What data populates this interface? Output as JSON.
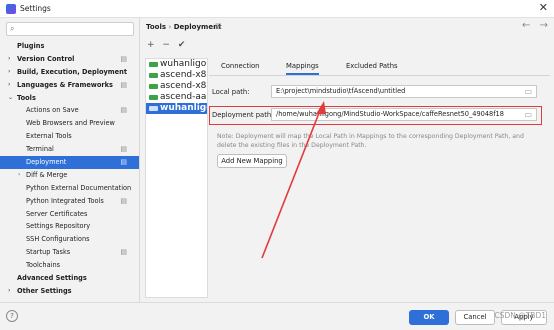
{
  "window": {
    "title": "Settings",
    "close_glyph": "✕"
  },
  "search": {
    "placeholder": "",
    "icon": "search-icon"
  },
  "tree": [
    {
      "label": "Plugins",
      "bold": true,
      "arrow": "",
      "indent": 0,
      "cfg": false,
      "selected": false
    },
    {
      "label": "Version Control",
      "bold": true,
      "arrow": "›",
      "indent": 0,
      "cfg": true,
      "selected": false
    },
    {
      "label": "Build, Execution, Deployment",
      "bold": true,
      "arrow": "›",
      "indent": 0,
      "cfg": false,
      "selected": false
    },
    {
      "label": "Languages & Frameworks",
      "bold": true,
      "arrow": "›",
      "indent": 0,
      "cfg": true,
      "selected": false
    },
    {
      "label": "Tools",
      "bold": true,
      "arrow": "⌄",
      "indent": 0,
      "cfg": false,
      "selected": false
    },
    {
      "label": "Actions on Save",
      "bold": false,
      "arrow": "",
      "indent": 1,
      "cfg": true,
      "selected": false
    },
    {
      "label": "Web Browsers and Preview",
      "bold": false,
      "arrow": "",
      "indent": 1,
      "cfg": false,
      "selected": false
    },
    {
      "label": "External Tools",
      "bold": false,
      "arrow": "",
      "indent": 1,
      "cfg": false,
      "selected": false
    },
    {
      "label": "Terminal",
      "bold": false,
      "arrow": "",
      "indent": 1,
      "cfg": true,
      "selected": false
    },
    {
      "label": "Deployment",
      "bold": false,
      "arrow": "",
      "indent": 1,
      "cfg": true,
      "selected": true
    },
    {
      "label": "Diff & Merge",
      "bold": false,
      "arrow": "›",
      "indent": 1,
      "cfg": false,
      "selected": false
    },
    {
      "label": "Python External Documentation",
      "bold": false,
      "arrow": "",
      "indent": 1,
      "cfg": false,
      "selected": false
    },
    {
      "label": "Python Integrated Tools",
      "bold": false,
      "arrow": "",
      "indent": 1,
      "cfg": true,
      "selected": false
    },
    {
      "label": "Server Certificates",
      "bold": false,
      "arrow": "",
      "indent": 1,
      "cfg": false,
      "selected": false
    },
    {
      "label": "Settings Repository",
      "bold": false,
      "arrow": "",
      "indent": 1,
      "cfg": false,
      "selected": false
    },
    {
      "label": "SSH Configurations",
      "bold": false,
      "arrow": "",
      "indent": 1,
      "cfg": false,
      "selected": false
    },
    {
      "label": "Startup Tasks",
      "bold": false,
      "arrow": "",
      "indent": 1,
      "cfg": true,
      "selected": false
    },
    {
      "label": "Toolchains",
      "bold": false,
      "arrow": "",
      "indent": 1,
      "cfg": false,
      "selected": false
    },
    {
      "label": "Advanced Settings",
      "bold": true,
      "arrow": "",
      "indent": 0,
      "cfg": false,
      "selected": false
    },
    {
      "label": "Other Settings",
      "bold": true,
      "arrow": "›",
      "indent": 0,
      "cfg": false,
      "selected": false
    }
  ],
  "breadcrumb": {
    "parent": "Tools",
    "separator": "›",
    "current": "Deployment"
  },
  "nav": {
    "back": "←",
    "forward": "→"
  },
  "server_toolbar": {
    "add": "+",
    "remove": "−",
    "default": "✔"
  },
  "servers": [
    {
      "label": "wuhanligo",
      "selected": false
    },
    {
      "label": "ascend-x8",
      "selected": false
    },
    {
      "label": "ascend-x8",
      "selected": false
    },
    {
      "label": "ascend-aa",
      "selected": false
    },
    {
      "label": "wuhanligo",
      "selected": true
    }
  ],
  "tabs": {
    "connection": "Connection",
    "mappings": "Mappings",
    "excluded": "Excluded Paths"
  },
  "mapping": {
    "local_label": "Local path:",
    "local_value": "E:\\project\\mindstudio\\tfAscend\\untitled",
    "deploy_label": "Deployment path:",
    "deploy_value": "/home/wuhanligong/MindStudio-WorkSpace/caffeResnet50_49048f18",
    "note_label": "Note:",
    "note_text": "Deployment will map the Local Path in Mappings to the corresponding Deployment Path, and delete the existing files in the Deployment Path.",
    "add_button": "Add New Mapping"
  },
  "footer": {
    "help": "?",
    "ok": "OK",
    "cancel": "Cancel",
    "apply": "Apply",
    "watermark": "CSDN @TBD1"
  },
  "colors": {
    "accent": "#2e6fd8",
    "highlight": "#e23b3b"
  }
}
